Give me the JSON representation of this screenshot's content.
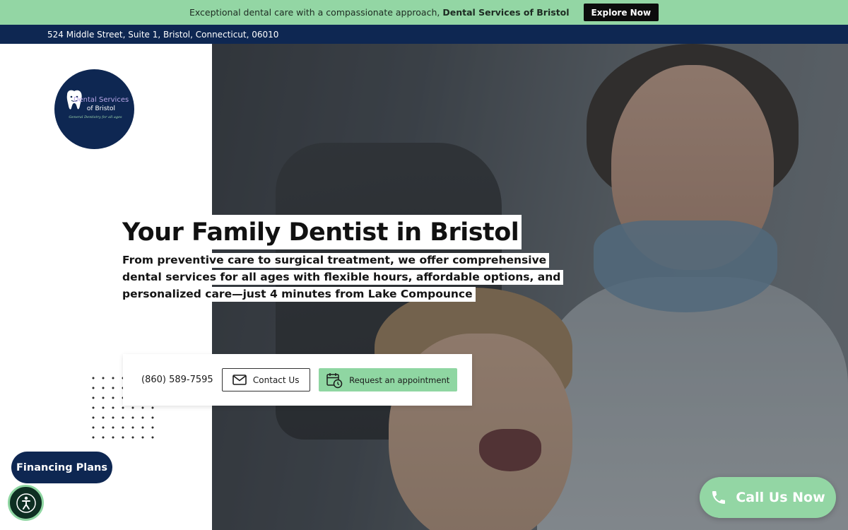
{
  "topbar": {
    "text": "Exceptional dental care with a compassionate approach,",
    "brand": "Dental Services of Bristol",
    "button_label": "Explore Now"
  },
  "address": "524 Middle Street, Suite 1, Bristol, Connecticut, 06010",
  "logo": {
    "line1": "Dental Services",
    "line2": "of Bristol",
    "tagline": "General Dentistry for all ages"
  },
  "hero": {
    "headline": "Your Family Dentist in Bristol",
    "sub_line1": "From preventive care to surgical treatment, we offer comprehensive",
    "sub_line2": "dental services for all ages with flexible hours, affordable options, and",
    "sub_line3": "personalized care—just 4 minutes from Lake Compounce"
  },
  "cta": {
    "phone": "(860) 589-7595",
    "contact_label": "Contact Us",
    "appointment_label": "Request an appointment"
  },
  "floating": {
    "financing_label": "Financing Plans",
    "call_label": "Call Us Now"
  },
  "colors": {
    "brand_navy": "#0e2752",
    "accent_green": "#93d6a4"
  },
  "icons": [
    "mail-icon",
    "calendar-clock-icon",
    "phone-icon",
    "accessibility-icon",
    "tooth-icon"
  ]
}
